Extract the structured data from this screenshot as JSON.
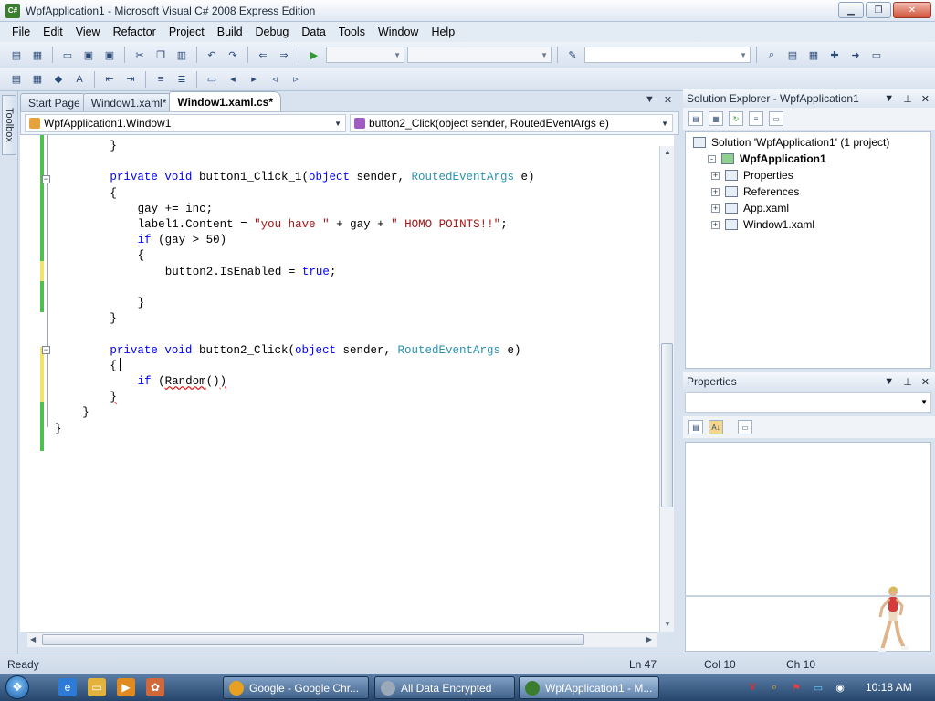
{
  "window": {
    "title": "WpfApplication1 - Microsoft Visual C# 2008 Express Edition",
    "app_icon_text": "C#",
    "controls": [
      "minimize",
      "maximize",
      "close"
    ]
  },
  "menu": [
    "File",
    "Edit",
    "View",
    "Refactor",
    "Project",
    "Build",
    "Debug",
    "Data",
    "Tools",
    "Window",
    "Help"
  ],
  "toolbox": {
    "label": "Toolbox"
  },
  "doc_tabs": [
    {
      "label": "Start Page",
      "active": false
    },
    {
      "label": "Window1.xaml*",
      "active": false
    },
    {
      "label": "Window1.xaml.cs*",
      "active": true
    }
  ],
  "nav": {
    "class_combo": "WpfApplication1.Window1",
    "member_combo": "button2_Click(object sender, RoutedEventArgs e)"
  },
  "code": {
    "lines": [
      {
        "indent": 8,
        "parts": [
          {
            "t": "}",
            "c": ""
          }
        ]
      },
      {
        "indent": 0,
        "parts": []
      },
      {
        "indent": 8,
        "parts": [
          {
            "t": "private",
            "c": "kw"
          },
          {
            "t": " ",
            "c": ""
          },
          {
            "t": "void",
            "c": "kw"
          },
          {
            "t": " button1_Click_1(",
            "c": ""
          },
          {
            "t": "object",
            "c": "kw"
          },
          {
            "t": " sender, ",
            "c": ""
          },
          {
            "t": "RoutedEventArgs",
            "c": "typ"
          },
          {
            "t": " e)",
            "c": ""
          }
        ]
      },
      {
        "indent": 8,
        "parts": [
          {
            "t": "{",
            "c": ""
          }
        ]
      },
      {
        "indent": 12,
        "parts": [
          {
            "t": "gay += inc;",
            "c": ""
          }
        ]
      },
      {
        "indent": 12,
        "parts": [
          {
            "t": "label1.Content = ",
            "c": ""
          },
          {
            "t": "\"you have \"",
            "c": "str"
          },
          {
            "t": " + gay + ",
            "c": ""
          },
          {
            "t": "\" HOMO POINTS!!\"",
            "c": "str"
          },
          {
            "t": ";",
            "c": ""
          }
        ]
      },
      {
        "indent": 12,
        "parts": [
          {
            "t": "if",
            "c": "kw"
          },
          {
            "t": " (gay > 50)",
            "c": ""
          }
        ]
      },
      {
        "indent": 12,
        "parts": [
          {
            "t": "{",
            "c": ""
          }
        ]
      },
      {
        "indent": 16,
        "parts": [
          {
            "t": "button2.IsEnabled = ",
            "c": ""
          },
          {
            "t": "true",
            "c": "kw"
          },
          {
            "t": ";",
            "c": ""
          }
        ]
      },
      {
        "indent": 0,
        "parts": []
      },
      {
        "indent": 12,
        "parts": [
          {
            "t": "}",
            "c": ""
          }
        ]
      },
      {
        "indent": 8,
        "parts": [
          {
            "t": "}",
            "c": ""
          }
        ]
      },
      {
        "indent": 0,
        "parts": []
      },
      {
        "indent": 8,
        "parts": [
          {
            "t": "private",
            "c": "kw"
          },
          {
            "t": " ",
            "c": ""
          },
          {
            "t": "void",
            "c": "kw"
          },
          {
            "t": " button2_Click(",
            "c": ""
          },
          {
            "t": "object",
            "c": "kw"
          },
          {
            "t": " sender, ",
            "c": ""
          },
          {
            "t": "RoutedEventArgs",
            "c": "typ"
          },
          {
            "t": " e)",
            "c": ""
          }
        ]
      },
      {
        "indent": 8,
        "parts": [
          {
            "t": "{",
            "c": ""
          }
        ]
      },
      {
        "indent": 12,
        "parts": [
          {
            "t": "if",
            "c": "kw"
          },
          {
            "t": " (",
            "c": ""
          },
          {
            "t": "Random",
            "c": "squiggle"
          },
          {
            "t": "()",
            "c": ""
          },
          {
            "t": ")",
            "c": "squiggle"
          }
        ]
      },
      {
        "indent": 8,
        "parts": [
          {
            "t": "}",
            "c": "squiggle"
          }
        ]
      },
      {
        "indent": 4,
        "parts": [
          {
            "t": "}",
            "c": ""
          }
        ]
      },
      {
        "indent": 0,
        "parts": [
          {
            "t": "}",
            "c": ""
          }
        ]
      }
    ]
  },
  "solution_explorer": {
    "title": "Solution Explorer - WpfApplication1",
    "items": [
      {
        "label": "Solution 'WpfApplication1' (1 project)",
        "level": 0,
        "expander": "",
        "bold": false
      },
      {
        "label": "WpfApplication1",
        "level": 1,
        "expander": "-",
        "bold": true
      },
      {
        "label": "Properties",
        "level": 2,
        "expander": "+",
        "bold": false
      },
      {
        "label": "References",
        "level": 2,
        "expander": "+",
        "bold": false
      },
      {
        "label": "App.xaml",
        "level": 2,
        "expander": "+",
        "bold": false
      },
      {
        "label": "Window1.xaml",
        "level": 2,
        "expander": "+",
        "bold": false
      }
    ]
  },
  "properties": {
    "title": "Properties"
  },
  "status": {
    "ready": "Ready",
    "ln": "Ln 47",
    "col": "Col 10",
    "ch": "Ch 10"
  },
  "taskbar": {
    "buttons": [
      {
        "label": "Google - Google Chr...",
        "icon_color": "#e8a020",
        "active": false
      },
      {
        "label": "All Data Encrypted",
        "icon_color": "#9aa8b8",
        "active": false
      },
      {
        "label": "WpfApplication1 - M...",
        "icon_color": "#3b7d2e",
        "active": true
      }
    ],
    "clock": "10:18 AM"
  },
  "colors": {
    "accent": "#3b7d2e",
    "change_bar": "#4fbf4f",
    "unsaved_bar": "#f2e36b"
  }
}
